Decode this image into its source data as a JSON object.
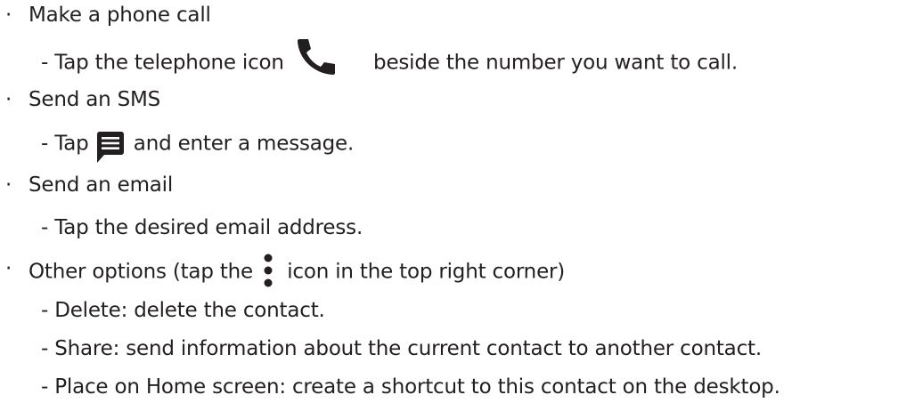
{
  "instructions": {
    "call": {
      "bullet": "·",
      "heading": "Make a phone call",
      "detail_before": "- Tap the telephone icon",
      "detail_after": "beside the number you want to call.",
      "icon": "phone-icon",
      "icon_color": "#231f20"
    },
    "sms": {
      "bullet": "·",
      "heading": "Send an SMS",
      "detail_before": "- Tap",
      "detail_after": "and enter a message.",
      "icon": "message-icon"
    },
    "email": {
      "bullet": "·",
      "heading": "Send an email",
      "detail": "- Tap the desired email address."
    },
    "options": {
      "bullet": "·",
      "heading_before": "Other options (tap the",
      "heading_after": "icon in the top right corner)",
      "icon": "more-vertical-icon",
      "items": [
        "- Delete: delete the contact.",
        "- Share: send information about the current contact to another contact.",
        "- Place on Home screen: create a shortcut to this contact on the desktop."
      ]
    }
  }
}
